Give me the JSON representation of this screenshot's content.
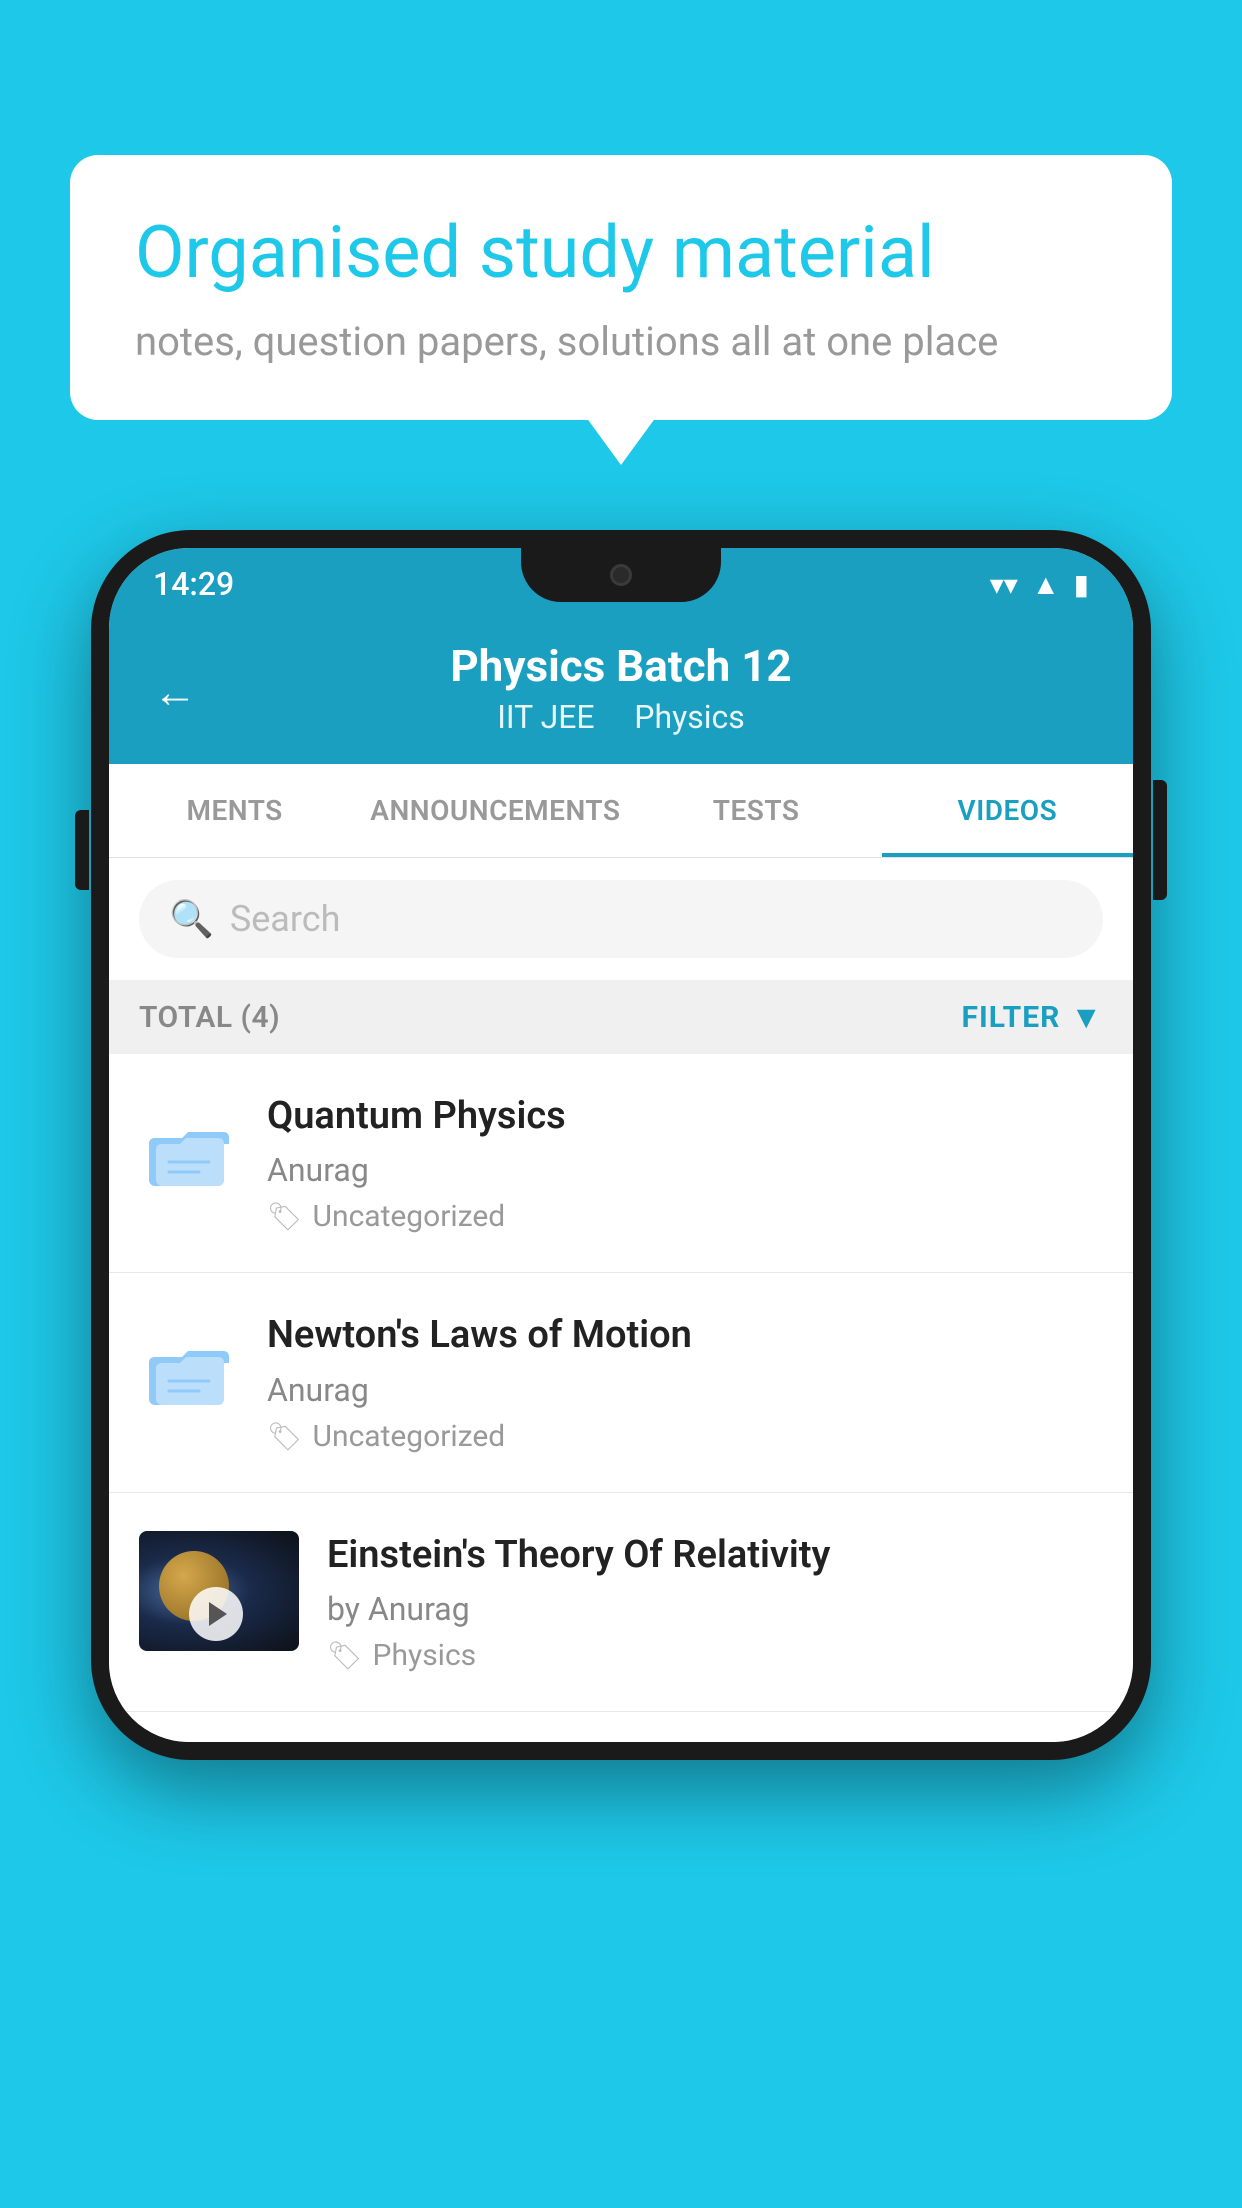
{
  "background": {
    "color": "#1EC8E8"
  },
  "speech_bubble": {
    "title": "Organised study material",
    "subtitle": "notes, question papers, solutions all at one place"
  },
  "phone": {
    "status_bar": {
      "time": "14:29",
      "icons": [
        "wifi",
        "signal",
        "battery"
      ]
    },
    "header": {
      "back_label": "←",
      "title": "Physics Batch 12",
      "subtitle_part1": "IIT JEE",
      "subtitle_sep": "   ",
      "subtitle_part2": "Physics"
    },
    "tabs": [
      {
        "label": "MENTS",
        "active": false
      },
      {
        "label": "ANNOUNCEMENTS",
        "active": false
      },
      {
        "label": "TESTS",
        "active": false
      },
      {
        "label": "VIDEOS",
        "active": true
      }
    ],
    "search": {
      "placeholder": "Search"
    },
    "filter_bar": {
      "total_label": "TOTAL (4)",
      "filter_label": "FILTER"
    },
    "videos": [
      {
        "id": 1,
        "title": "Quantum Physics",
        "author": "Anurag",
        "tag": "Uncategorized",
        "has_thumbnail": false
      },
      {
        "id": 2,
        "title": "Newton's Laws of Motion",
        "author": "Anurag",
        "tag": "Uncategorized",
        "has_thumbnail": false
      },
      {
        "id": 3,
        "title": "Einstein's Theory Of Relativity",
        "author": "by Anurag",
        "tag": "Physics",
        "has_thumbnail": true
      }
    ]
  }
}
